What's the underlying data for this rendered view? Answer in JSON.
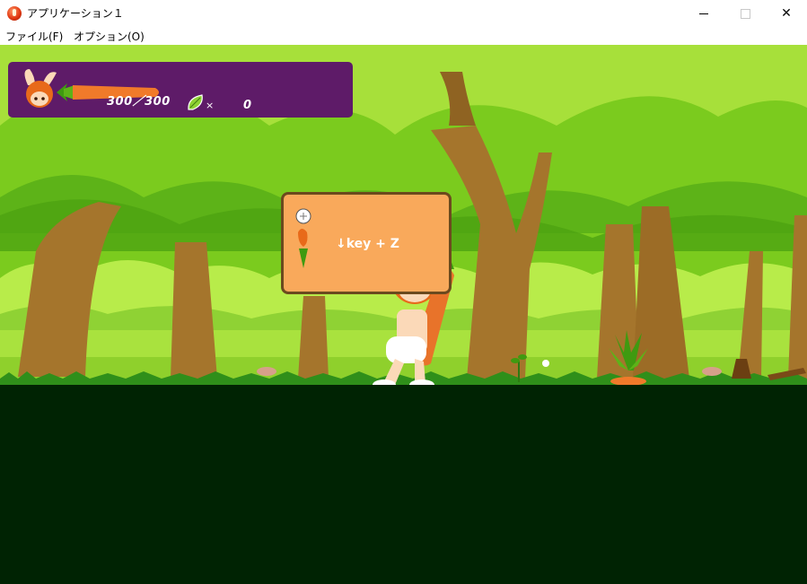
{
  "window": {
    "title": "アプリケーション１",
    "minimize_icon": "minimize-icon",
    "maximize_icon": "maximize-icon",
    "close_glyph": "✕"
  },
  "menu": {
    "items": [
      {
        "label": "ファイル(F)"
      },
      {
        "label": "オプション(O)"
      }
    ]
  },
  "hud": {
    "hp_text": "300／300",
    "hp_fraction": 1.0,
    "item_multiplier": "×",
    "item_count": "0",
    "panel_color": "#5e1b68"
  },
  "sign": {
    "instruction": "↓key + Z",
    "icon": "leaf-hint-icon",
    "panel_color": "#f9a95b"
  },
  "colors": {
    "foliage": "#79c81c",
    "foliage_dark": "#3f9a10",
    "trunk": "#a5752c",
    "ground": "#002303",
    "grass": "#2f8f1a",
    "carrot": "#f07a2a"
  }
}
